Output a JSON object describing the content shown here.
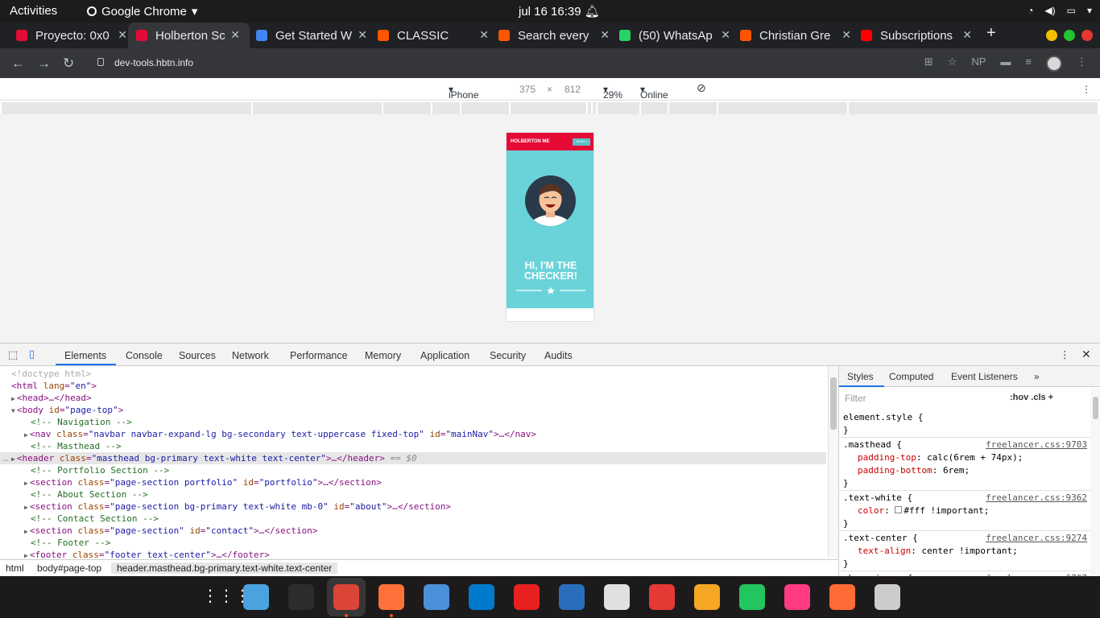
{
  "os_bar": {
    "activities": "Activities",
    "app_name": "Google Chrome",
    "datetime": "jul 16  16:39"
  },
  "tabs": [
    {
      "title": "Proyecto: 0x0",
      "favicon_color": "#e50b36",
      "active": false
    },
    {
      "title": "Holberton Sc",
      "favicon_color": "#e50b36",
      "active": true
    },
    {
      "title": "Get Started W",
      "favicon_color": "#4285f4",
      "active": false
    },
    {
      "title": "CLASSIC",
      "favicon_color": "#ff5500",
      "active": false
    },
    {
      "title": "Search every",
      "favicon_color": "#ff5500",
      "active": false
    },
    {
      "title": "(50) WhatsAp",
      "favicon_color": "#25d366",
      "active": false
    },
    {
      "title": "Christian Gre",
      "favicon_color": "#ff5500",
      "active": false
    },
    {
      "title": "Subscriptions",
      "favicon_color": "#ff0000",
      "active": false
    }
  ],
  "new_tab_label": "+",
  "omnibox": {
    "url": "dev-tools.hbtn.info",
    "np_label": "NP"
  },
  "device_toolbar": {
    "device": "iPhone X",
    "width": "375",
    "times": "×",
    "height": "812",
    "zoom": "29%",
    "network": "Online"
  },
  "phone": {
    "brand": "HOLBERTON ME",
    "menu_label": "MENU ≡",
    "heading": "HI, I'M THE CHECKER!"
  },
  "devtools_tabs": [
    "Elements",
    "Console",
    "Sources",
    "Network",
    "Performance",
    "Memory",
    "Application",
    "Security",
    "Audits"
  ],
  "elements_lines": [
    {
      "indent": 0,
      "tri": "",
      "html": "<span class=\"dim\">&lt;!doctype html&gt;</span>"
    },
    {
      "indent": 0,
      "tri": "",
      "html": "<span class=\"tag\">&lt;html</span> <span class=\"an\">lang</span>=<span class=\"av\">\"en\"</span><span class=\"tag\">&gt;</span>"
    },
    {
      "indent": 1,
      "tri": "▶",
      "html": "<span class=\"tag\">&lt;head&gt;</span>…<span class=\"tag\">&lt;/head&gt;</span>"
    },
    {
      "indent": 1,
      "tri": "▼",
      "html": "<span class=\"tag\">&lt;body</span> <span class=\"an\">id</span>=<span class=\"av\">\"page-top\"</span><span class=\"tag\">&gt;</span>"
    },
    {
      "indent": 3,
      "tri": "",
      "html": "<span class=\"cm\">&lt;!-- Navigation --&gt;</span>"
    },
    {
      "indent": 3,
      "tri": "▶",
      "html": "<span class=\"tag\">&lt;nav</span> <span class=\"an\">class</span>=<span class=\"av\">\"navbar navbar-expand-lg bg-secondary text-uppercase fixed-top\"</span> <span class=\"an\">id</span>=<span class=\"av\">\"mainNav\"</span><span class=\"tag\">&gt;</span>…<span class=\"tag\">&lt;/nav&gt;</span>"
    },
    {
      "indent": 3,
      "tri": "",
      "html": "<span class=\"cm\">&lt;!-- Masthead --&gt;</span>"
    },
    {
      "indent": 3,
      "tri": "▶",
      "sel": true,
      "html": "<span class=\"tag\">&lt;header</span> <span class=\"an\">class</span>=<span class=\"av\">\"masthead bg-primary text-white text-center\"</span><span class=\"tag\">&gt;</span>…<span class=\"tag\">&lt;/header&gt;</span> <span class=\"eq\">== $0</span>"
    },
    {
      "indent": 3,
      "tri": "",
      "html": "<span class=\"cm\">&lt;!-- Portfolio Section --&gt;</span>"
    },
    {
      "indent": 3,
      "tri": "▶",
      "html": "<span class=\"tag\">&lt;section</span> <span class=\"an\">class</span>=<span class=\"av\">\"page-section portfolio\"</span> <span class=\"an\">id</span>=<span class=\"av\">\"portfolio\"</span><span class=\"tag\">&gt;</span>…<span class=\"tag\">&lt;/section&gt;</span>"
    },
    {
      "indent": 3,
      "tri": "",
      "html": "<span class=\"cm\">&lt;!-- About Section --&gt;</span>"
    },
    {
      "indent": 3,
      "tri": "▶",
      "html": "<span class=\"tag\">&lt;section</span> <span class=\"an\">class</span>=<span class=\"av\">\"page-section bg-primary text-white mb-0\"</span> <span class=\"an\">id</span>=<span class=\"av\">\"about\"</span><span class=\"tag\">&gt;</span>…<span class=\"tag\">&lt;/section&gt;</span>"
    },
    {
      "indent": 3,
      "tri": "",
      "html": "<span class=\"cm\">&lt;!-- Contact Section --&gt;</span>"
    },
    {
      "indent": 3,
      "tri": "▶",
      "html": "<span class=\"tag\">&lt;section</span> <span class=\"an\">class</span>=<span class=\"av\">\"page-section\"</span> <span class=\"an\">id</span>=<span class=\"av\">\"contact\"</span><span class=\"tag\">&gt;</span>…<span class=\"tag\">&lt;/section&gt;</span>"
    },
    {
      "indent": 3,
      "tri": "",
      "html": "<span class=\"cm\">&lt;!-- Footer --&gt;</span>"
    },
    {
      "indent": 3,
      "tri": "▶",
      "html": "<span class=\"tag\">&lt;footer</span> <span class=\"an\">class</span>=<span class=\"av\">\"footer text-center\"</span><span class=\"tag\">&gt;</span>…<span class=\"tag\">&lt;/footer&gt;</span>"
    }
  ],
  "breadcrumbs": [
    "html",
    "body#page-top",
    "header.masthead.bg-primary.text-white.text-center"
  ],
  "styles_tabs": [
    "Styles",
    "Computed",
    "Event Listeners",
    "»"
  ],
  "styles_filter_placeholder": "Filter",
  "styles_filter_opts": ":hov  .cls  +",
  "style_rules": [
    {
      "selector": "element.style {",
      "source": "",
      "props": [],
      "close": "}"
    },
    {
      "selector": ".masthead {",
      "source": "freelancer.css:9703",
      "props": [
        [
          "padding-top",
          "calc(6rem + 74px);"
        ],
        [
          "padding-bottom",
          "6rem;"
        ]
      ],
      "close": "}"
    },
    {
      "selector": ".text-white {",
      "source": "freelancer.css:9362",
      "props": [
        [
          "color",
          "#fff !important;"
        ]
      ],
      "close": "}"
    },
    {
      "selector": ".text-center {",
      "source": "freelancer.css:9274",
      "props": [
        [
          "text-align",
          "center !important;"
        ]
      ],
      "close": "}"
    },
    {
      "selector": ".bg-primary {",
      "source": "freelancer.css:6707",
      "props": [],
      "close": ""
    }
  ],
  "dock_apps": [
    {
      "name": "show-applications",
      "color": "#1d1a1b"
    },
    {
      "name": "files",
      "color": "#4aa3df"
    },
    {
      "name": "terminal",
      "color": "#2c2c2c"
    },
    {
      "name": "chrome",
      "color": "#db4437",
      "running": true
    },
    {
      "name": "firefox",
      "color": "#ff7139",
      "running": true
    },
    {
      "name": "thunderbird",
      "color": "#4a90d9"
    },
    {
      "name": "vscode",
      "color": "#007acc"
    },
    {
      "name": "music",
      "color": "#e82020"
    },
    {
      "name": "writer",
      "color": "#2a6ebb"
    },
    {
      "name": "installer",
      "color": "#e0e0e0"
    },
    {
      "name": "help",
      "color": "#e53935"
    },
    {
      "name": "amazon",
      "color": "#f5a623"
    },
    {
      "name": "updater",
      "color": "#22c55e"
    },
    {
      "name": "video",
      "color": "#ff3b81"
    },
    {
      "name": "notes",
      "color": "#ff6b35"
    },
    {
      "name": "trash",
      "color": "#cccccc"
    }
  ]
}
